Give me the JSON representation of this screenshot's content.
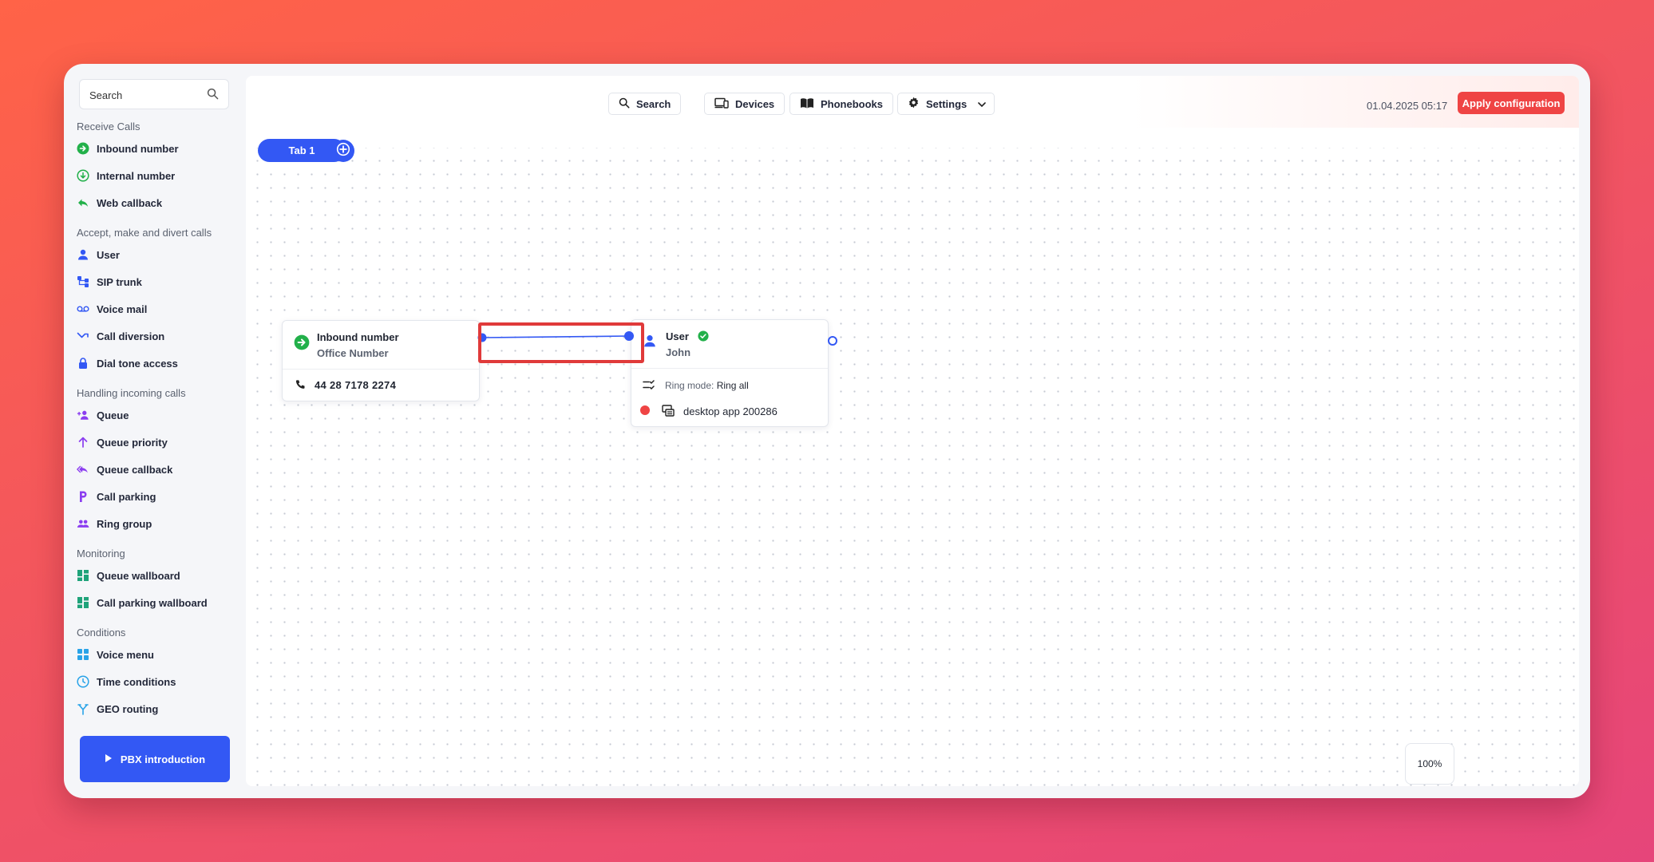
{
  "sidebar": {
    "search_placeholder": "Search",
    "sections": {
      "receive": "Receive Calls",
      "accept": "Accept, make and divert calls",
      "handling": "Handling incoming calls",
      "monitoring": "Monitoring",
      "conditions": "Conditions"
    },
    "items": {
      "inbound_number": "Inbound number",
      "internal_number": "Internal number",
      "web_callback": "Web callback",
      "user": "User",
      "sip_trunk": "SIP trunk",
      "voice_mail": "Voice mail",
      "call_diversion": "Call diversion",
      "dial_tone_access": "Dial tone access",
      "queue": "Queue",
      "queue_priority": "Queue priority",
      "queue_callback": "Queue callback",
      "call_parking": "Call parking",
      "ring_group": "Ring group",
      "queue_wallboard": "Queue wallboard",
      "call_parking_wallboard": "Call parking wallboard",
      "voice_menu": "Voice menu",
      "time_conditions": "Time conditions",
      "geo_routing": "GEO routing"
    },
    "pbx_intro": "PBX introduction"
  },
  "toolbar": {
    "search": "Search",
    "devices": "Devices",
    "phonebooks": "Phonebooks",
    "settings": "Settings",
    "datetime": "01.04.2025 05:17",
    "apply": "Apply configuration"
  },
  "tabs": [
    {
      "label": "Tab 1"
    }
  ],
  "canvas": {
    "inbound_node": {
      "title": "Inbound number",
      "subtitle": "Office Number",
      "phone": "44 28 7178 2274"
    },
    "user_node": {
      "title": "User",
      "subtitle": "John",
      "ring_mode_label": "Ring mode:",
      "ring_mode_value": "Ring all",
      "device": "desktop app 200286"
    },
    "zoom": "100%"
  },
  "colors": {
    "primary": "#3358f4",
    "danger": "#ef4444",
    "success": "#22b04a",
    "highlight": "#e03a3a"
  }
}
